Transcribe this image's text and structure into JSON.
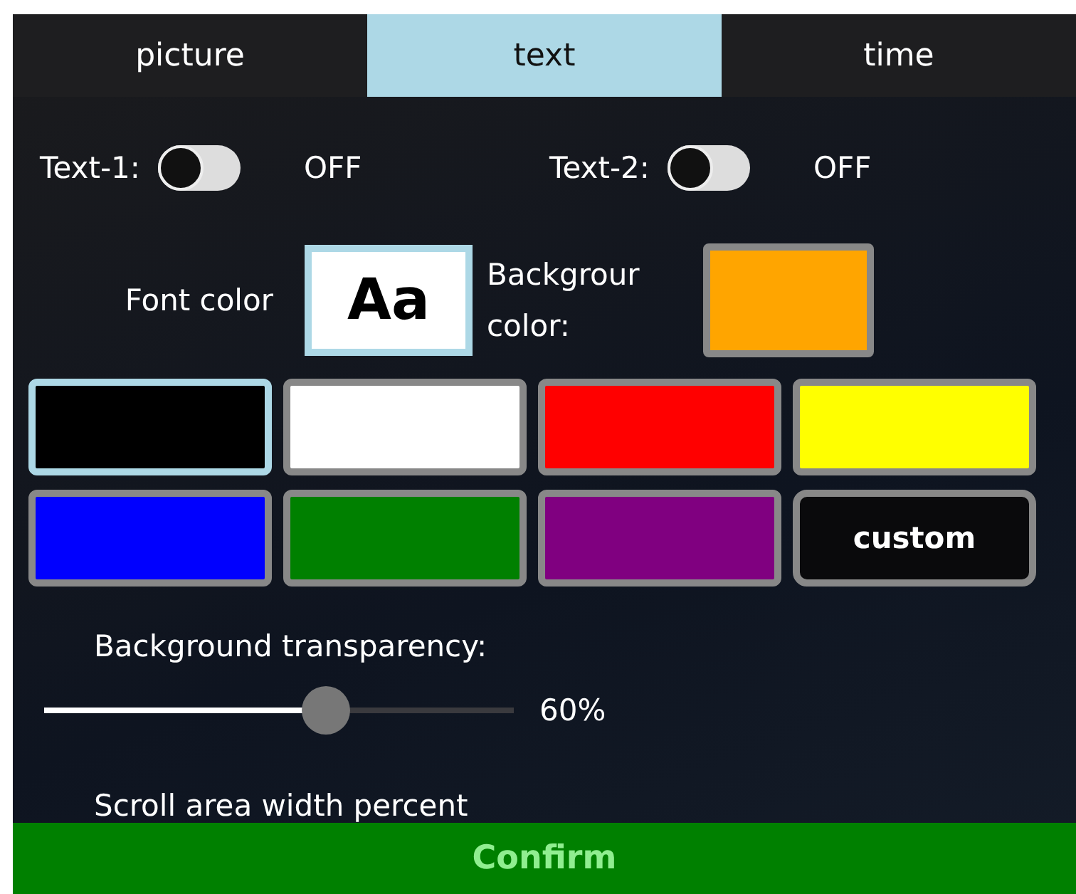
{
  "tabs": [
    {
      "label": "picture",
      "selected": false
    },
    {
      "label": "text",
      "selected": true
    },
    {
      "label": "time",
      "selected": false
    }
  ],
  "toggles": [
    {
      "label": "Text-1:",
      "on": false,
      "state": "OFF"
    },
    {
      "label": "Text-2:",
      "on": false,
      "state": "OFF"
    }
  ],
  "font_color": {
    "label": "Font color",
    "sample": "Aa",
    "color": "#ffffff",
    "selected": true
  },
  "background_color": {
    "label_lines": [
      "Backgrour",
      "color:"
    ],
    "color": "#ffa500",
    "selected": false
  },
  "palette": [
    {
      "kind": "swatch",
      "color": "#000000",
      "selected": true
    },
    {
      "kind": "swatch",
      "color": "#ffffff",
      "selected": false
    },
    {
      "kind": "swatch",
      "color": "#ff0000",
      "selected": false
    },
    {
      "kind": "swatch",
      "color": "#ffff00",
      "selected": false
    },
    {
      "kind": "swatch",
      "color": "#0000ff",
      "selected": false
    },
    {
      "kind": "swatch",
      "color": "#008000",
      "selected": false
    },
    {
      "kind": "swatch",
      "color": "#800080",
      "selected": false
    },
    {
      "kind": "custom",
      "label": "custom",
      "selected": false
    }
  ],
  "transparency": {
    "label": "Background transparency:",
    "level": 0.6,
    "reading": "60%"
  },
  "scroll_width": {
    "label": "Scroll area width percent"
  },
  "confirm": {
    "label": "Confirm"
  }
}
